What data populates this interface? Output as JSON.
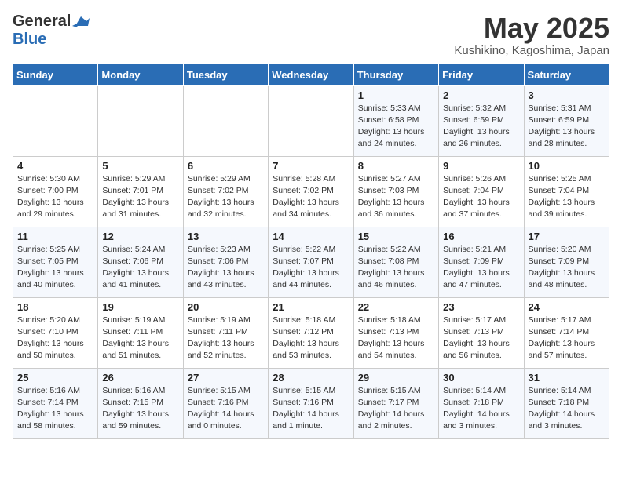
{
  "header": {
    "logo_general": "General",
    "logo_blue": "Blue",
    "month_title": "May 2025",
    "location": "Kushikino, Kagoshima, Japan"
  },
  "weekdays": [
    "Sunday",
    "Monday",
    "Tuesday",
    "Wednesday",
    "Thursday",
    "Friday",
    "Saturday"
  ],
  "weeks": [
    [
      {
        "day": "",
        "info": ""
      },
      {
        "day": "",
        "info": ""
      },
      {
        "day": "",
        "info": ""
      },
      {
        "day": "",
        "info": ""
      },
      {
        "day": "1",
        "info": "Sunrise: 5:33 AM\nSunset: 6:58 PM\nDaylight: 13 hours\nand 24 minutes."
      },
      {
        "day": "2",
        "info": "Sunrise: 5:32 AM\nSunset: 6:59 PM\nDaylight: 13 hours\nand 26 minutes."
      },
      {
        "day": "3",
        "info": "Sunrise: 5:31 AM\nSunset: 6:59 PM\nDaylight: 13 hours\nand 28 minutes."
      }
    ],
    [
      {
        "day": "4",
        "info": "Sunrise: 5:30 AM\nSunset: 7:00 PM\nDaylight: 13 hours\nand 29 minutes."
      },
      {
        "day": "5",
        "info": "Sunrise: 5:29 AM\nSunset: 7:01 PM\nDaylight: 13 hours\nand 31 minutes."
      },
      {
        "day": "6",
        "info": "Sunrise: 5:29 AM\nSunset: 7:02 PM\nDaylight: 13 hours\nand 32 minutes."
      },
      {
        "day": "7",
        "info": "Sunrise: 5:28 AM\nSunset: 7:02 PM\nDaylight: 13 hours\nand 34 minutes."
      },
      {
        "day": "8",
        "info": "Sunrise: 5:27 AM\nSunset: 7:03 PM\nDaylight: 13 hours\nand 36 minutes."
      },
      {
        "day": "9",
        "info": "Sunrise: 5:26 AM\nSunset: 7:04 PM\nDaylight: 13 hours\nand 37 minutes."
      },
      {
        "day": "10",
        "info": "Sunrise: 5:25 AM\nSunset: 7:04 PM\nDaylight: 13 hours\nand 39 minutes."
      }
    ],
    [
      {
        "day": "11",
        "info": "Sunrise: 5:25 AM\nSunset: 7:05 PM\nDaylight: 13 hours\nand 40 minutes."
      },
      {
        "day": "12",
        "info": "Sunrise: 5:24 AM\nSunset: 7:06 PM\nDaylight: 13 hours\nand 41 minutes."
      },
      {
        "day": "13",
        "info": "Sunrise: 5:23 AM\nSunset: 7:06 PM\nDaylight: 13 hours\nand 43 minutes."
      },
      {
        "day": "14",
        "info": "Sunrise: 5:22 AM\nSunset: 7:07 PM\nDaylight: 13 hours\nand 44 minutes."
      },
      {
        "day": "15",
        "info": "Sunrise: 5:22 AM\nSunset: 7:08 PM\nDaylight: 13 hours\nand 46 minutes."
      },
      {
        "day": "16",
        "info": "Sunrise: 5:21 AM\nSunset: 7:09 PM\nDaylight: 13 hours\nand 47 minutes."
      },
      {
        "day": "17",
        "info": "Sunrise: 5:20 AM\nSunset: 7:09 PM\nDaylight: 13 hours\nand 48 minutes."
      }
    ],
    [
      {
        "day": "18",
        "info": "Sunrise: 5:20 AM\nSunset: 7:10 PM\nDaylight: 13 hours\nand 50 minutes."
      },
      {
        "day": "19",
        "info": "Sunrise: 5:19 AM\nSunset: 7:11 PM\nDaylight: 13 hours\nand 51 minutes."
      },
      {
        "day": "20",
        "info": "Sunrise: 5:19 AM\nSunset: 7:11 PM\nDaylight: 13 hours\nand 52 minutes."
      },
      {
        "day": "21",
        "info": "Sunrise: 5:18 AM\nSunset: 7:12 PM\nDaylight: 13 hours\nand 53 minutes."
      },
      {
        "day": "22",
        "info": "Sunrise: 5:18 AM\nSunset: 7:13 PM\nDaylight: 13 hours\nand 54 minutes."
      },
      {
        "day": "23",
        "info": "Sunrise: 5:17 AM\nSunset: 7:13 PM\nDaylight: 13 hours\nand 56 minutes."
      },
      {
        "day": "24",
        "info": "Sunrise: 5:17 AM\nSunset: 7:14 PM\nDaylight: 13 hours\nand 57 minutes."
      }
    ],
    [
      {
        "day": "25",
        "info": "Sunrise: 5:16 AM\nSunset: 7:14 PM\nDaylight: 13 hours\nand 58 minutes."
      },
      {
        "day": "26",
        "info": "Sunrise: 5:16 AM\nSunset: 7:15 PM\nDaylight: 13 hours\nand 59 minutes."
      },
      {
        "day": "27",
        "info": "Sunrise: 5:15 AM\nSunset: 7:16 PM\nDaylight: 14 hours\nand 0 minutes."
      },
      {
        "day": "28",
        "info": "Sunrise: 5:15 AM\nSunset: 7:16 PM\nDaylight: 14 hours\nand 1 minute."
      },
      {
        "day": "29",
        "info": "Sunrise: 5:15 AM\nSunset: 7:17 PM\nDaylight: 14 hours\nand 2 minutes."
      },
      {
        "day": "30",
        "info": "Sunrise: 5:14 AM\nSunset: 7:18 PM\nDaylight: 14 hours\nand 3 minutes."
      },
      {
        "day": "31",
        "info": "Sunrise: 5:14 AM\nSunset: 7:18 PM\nDaylight: 14 hours\nand 3 minutes."
      }
    ]
  ]
}
